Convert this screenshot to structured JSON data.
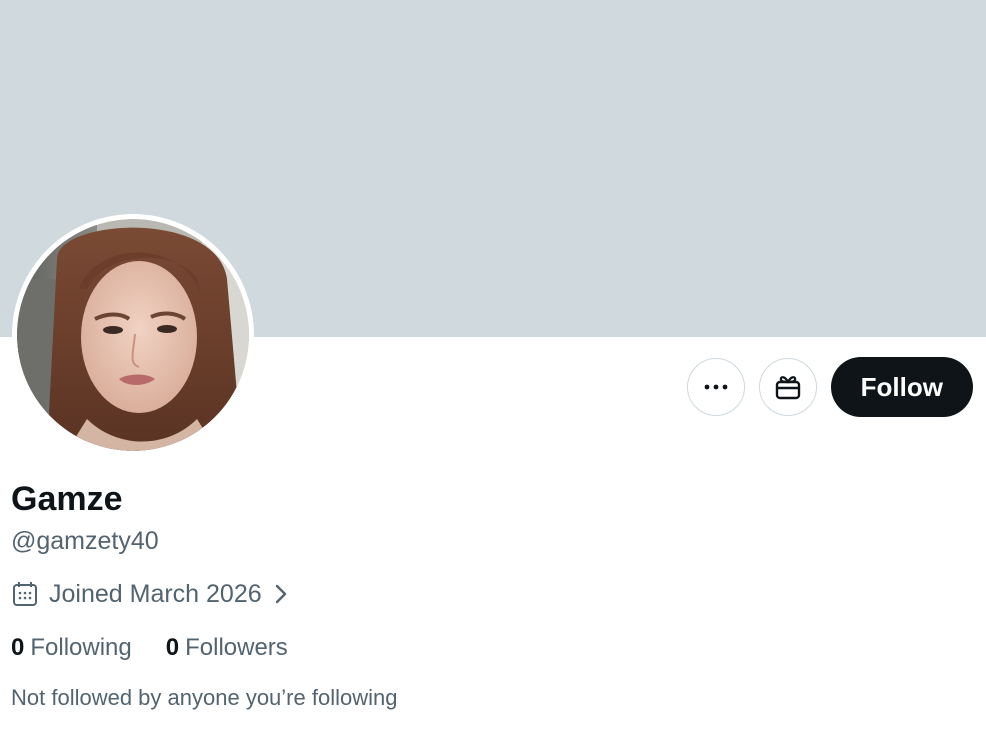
{
  "profile": {
    "display_name": "Gamze",
    "handle": "@gamzety40",
    "joined": "Joined March 2026",
    "stats": {
      "following_count": "0",
      "following_label": "Following",
      "followers_count": "0",
      "followers_label": "Followers"
    },
    "mutuals_note": "Not followed by anyone you’re following"
  },
  "actions": {
    "follow_label": "Follow",
    "more_icon": "more-horizontal-icon",
    "gift_icon": "gift-icon"
  },
  "icons": {
    "calendar": "calendar-icon",
    "chevron": "chevron-right-icon"
  },
  "colors": {
    "banner": "#cfd9de",
    "primary_text": "#0f1419",
    "secondary_text": "#536471",
    "follow_bg": "#0f1419",
    "follow_text": "#ffffff"
  }
}
